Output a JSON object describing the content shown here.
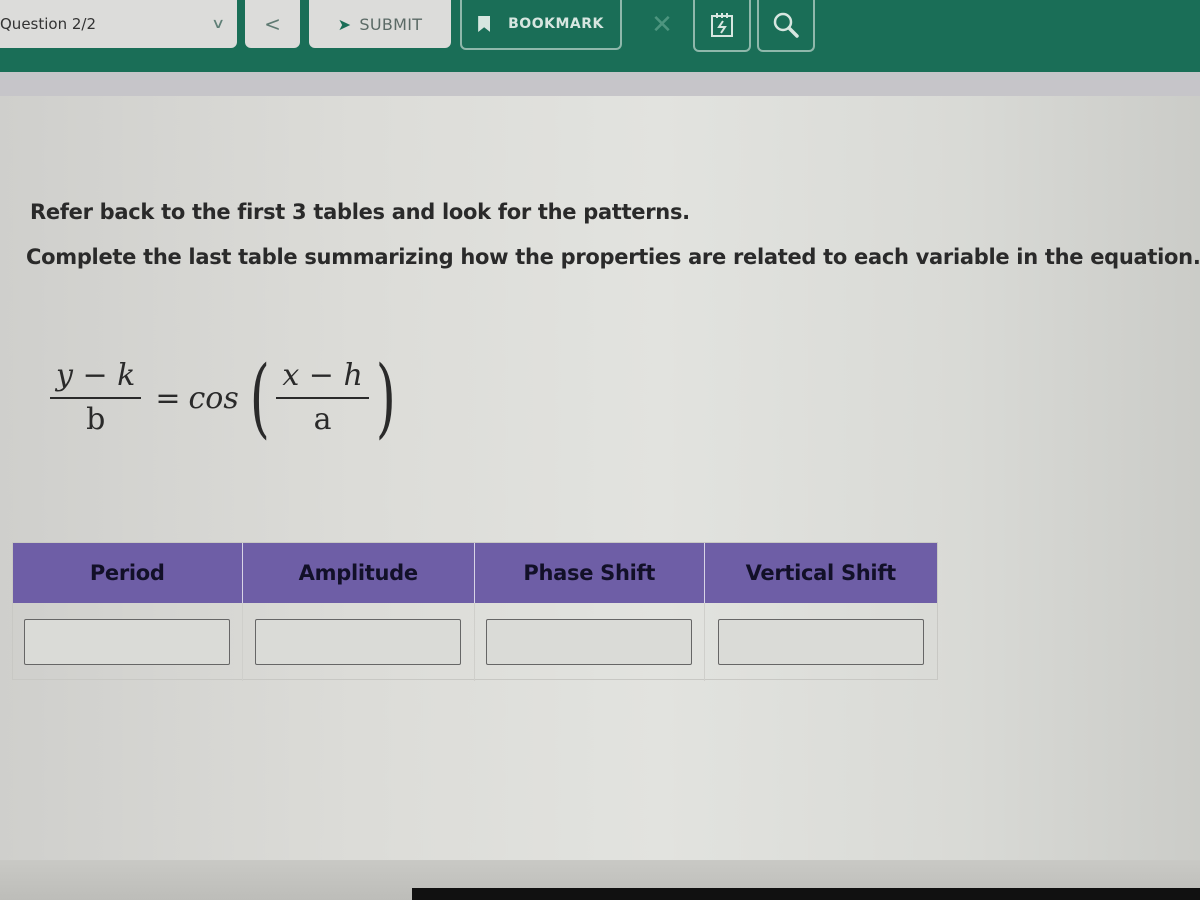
{
  "toolbar": {
    "question_selector": {
      "label": "Question 2/2",
      "icon": "chevron-down-icon"
    },
    "back": {
      "icon": "chevron-left-icon",
      "glyph": "<"
    },
    "submit": {
      "label": "SUBMIT",
      "icon": "paper-plane-icon"
    },
    "bookmark": {
      "label": "BOOKMARK",
      "icon": "bookmark-icon"
    },
    "close": {
      "icon": "close-icon",
      "glyph": "✕"
    },
    "calculator": {
      "icon": "calendar-icon"
    },
    "search": {
      "icon": "search-icon"
    },
    "colors": {
      "bar": "#1a6e57",
      "light": "#dcdcda"
    }
  },
  "instructions": {
    "line1": "Refer back to the first 3 tables and look for the patterns.",
    "line2": "Complete the last table summarizing how the properties are related to each variable in the equation."
  },
  "equation": {
    "left_numerator": "y − k",
    "left_denominator": "b",
    "equals": "=",
    "function": "cos",
    "right_numerator": "x − h",
    "right_denominator": "a",
    "open_paren": "(",
    "close_paren": ")"
  },
  "table": {
    "header_color": "#6e5ea6",
    "columns": [
      "Period",
      "Amplitude",
      "Phase Shift",
      "Vertical Shift"
    ],
    "inputs": [
      {
        "value": "",
        "placeholder": ""
      },
      {
        "value": "",
        "placeholder": ""
      },
      {
        "value": "",
        "placeholder": ""
      },
      {
        "value": "",
        "placeholder": ""
      }
    ]
  }
}
